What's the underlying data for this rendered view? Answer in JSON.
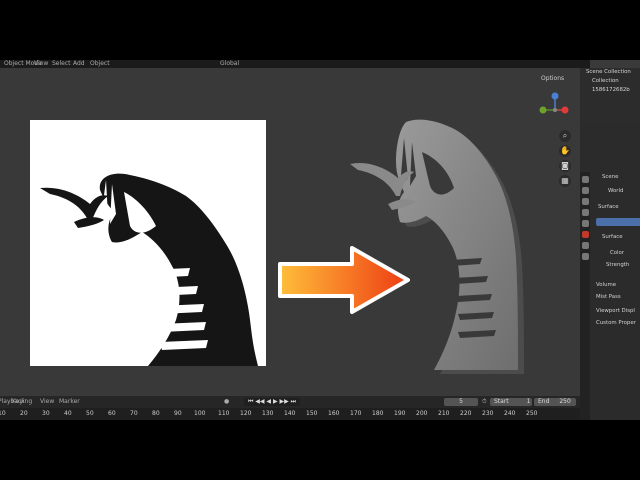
{
  "topbar": {
    "menus": [
      "Object Mode",
      "View",
      "Select",
      "Add",
      "Object"
    ],
    "transform": "Global"
  },
  "viewport": {
    "options_label": "Options",
    "tools": [
      "zoom-icon",
      "hand-icon",
      "camera-icon",
      "grid-icon"
    ]
  },
  "timeline": {
    "menu": [
      "Playback",
      "Keying",
      "View",
      "Marker"
    ],
    "current_frame": "5",
    "start_label": "Start",
    "start_value": "1",
    "end_label": "End",
    "end_value": "250",
    "ruler": [
      "10",
      "20",
      "30",
      "40",
      "50",
      "60",
      "70",
      "80",
      "90",
      "100",
      "110",
      "120",
      "130",
      "140",
      "150",
      "160",
      "170",
      "180",
      "190",
      "200",
      "210",
      "220",
      "230",
      "240",
      "250"
    ]
  },
  "outliner": {
    "scene_collection": "Scene Collection",
    "collection": "Collection",
    "object": "1586172682b"
  },
  "properties": {
    "scene": "Scene",
    "world": "World",
    "surface_header": "Surface",
    "surface_label": "Surface",
    "color_label": "Color",
    "strength_label": "Strength",
    "sections": [
      "Volume",
      "Mist Pass",
      "Viewport Displ",
      "Custom Proper"
    ]
  },
  "colors": {
    "background": "#393939",
    "arrow_start": "#ffbe3b",
    "arrow_end": "#ee3c12",
    "accent": "#4b6fa8"
  }
}
